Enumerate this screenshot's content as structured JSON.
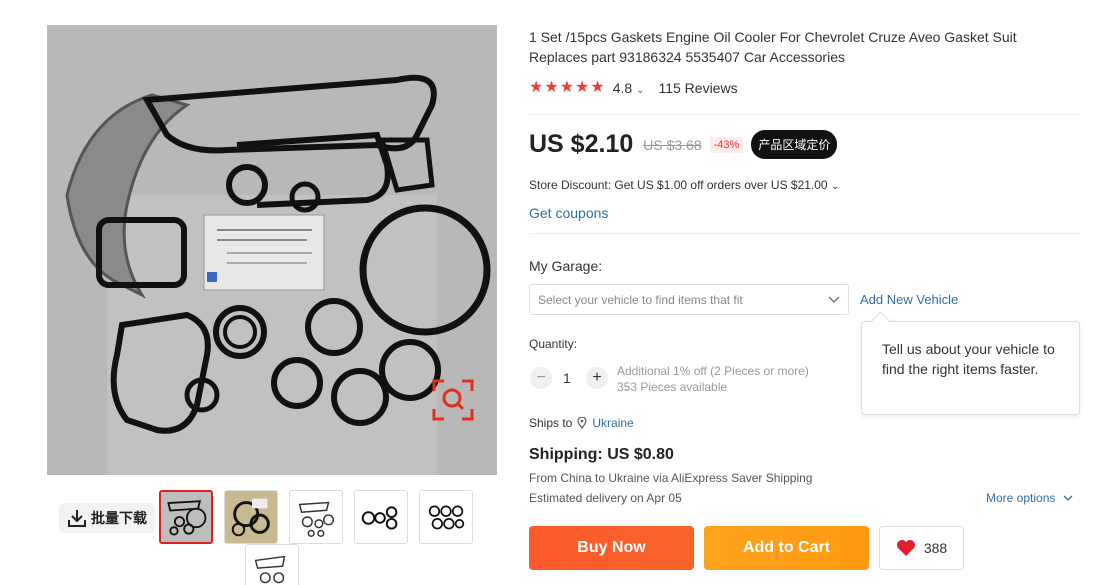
{
  "product": {
    "title": "1 Set /15pcs Gaskets Engine Oil Cooler For Chevrolet Cruze Aveo Gasket Suit Replaces part 93186324 5535407 Car Accessories",
    "rating": "4.8",
    "reviews": "115 Reviews",
    "stars": 5
  },
  "price": {
    "current": "US $2.10",
    "original": "US $3.68",
    "discount": "-43%",
    "region_badge": "产品区域定价"
  },
  "store_discount": "Store Discount: Get US $1.00 off orders over US $21.00",
  "coupons_link": "Get coupons",
  "garage": {
    "label": "My Garage:",
    "placeholder": "Select your vehicle to find items that fit",
    "add_link": "Add New Vehicle",
    "tooltip": "Tell us about your vehicle to find the right items faster."
  },
  "quantity": {
    "label": "Quantity:",
    "value": "1",
    "minus": "−",
    "plus": "+",
    "note_line1": "Additional 1% off (2 Pieces or more)",
    "note_line2": "353 Pieces available"
  },
  "shipping": {
    "ships_to_label": "Ships to",
    "country": "Ukraine",
    "cost": "Shipping: US $0.80",
    "from": "From China to Ukraine via AliExpress Saver Shipping",
    "delivery": "Estimated delivery on Apr 05",
    "more_options": "More options"
  },
  "actions": {
    "buy_now": "Buy Now",
    "add_to_cart": "Add to Cart",
    "wish_count": "388"
  },
  "gallery": {
    "batch_download": "批量下载",
    "thumbnail_count": 6,
    "active_thumbnail": 1
  },
  "colors": {
    "star": "#ee3d3d",
    "link": "#2e6fa4",
    "buy_now": "#ff5a2c",
    "add_to_cart": "#ffa21d",
    "heart": "#e0202c"
  }
}
